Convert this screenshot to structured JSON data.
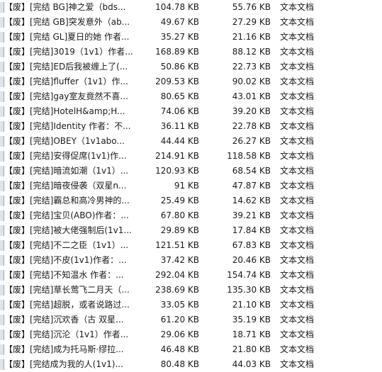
{
  "files": [
    {
      "name": "【废】[完结 BG]神之爱（bds...",
      "size": "104.78 KB",
      "csize": "55.76 KB",
      "type": "文本文档"
    },
    {
      "name": "【废】[完结 GB]突发意外（ab...",
      "size": "49.67 KB",
      "csize": "27.29 KB",
      "type": "文本文档"
    },
    {
      "name": "【废】[完结 GL]夏日的她 作者...",
      "size": "35.27 KB",
      "csize": "21.16 KB",
      "type": "文本文档"
    },
    {
      "name": "【废】[完结]3019（1v1）作者...",
      "size": "168.89 KB",
      "csize": "88.12 KB",
      "type": "文本文档"
    },
    {
      "name": "【废】[完结]ED后我被缠上了(...",
      "size": "50.86 KB",
      "csize": "22.73 KB",
      "type": "文本文档"
    },
    {
      "name": "【废】[完结]fluffer（1v1）作...",
      "size": "209.53 KB",
      "csize": "90.02 KB",
      "type": "文本文档"
    },
    {
      "name": "【废】[完结]gay室友竟然不喜...",
      "size": "80.65 KB",
      "csize": "43.01 KB",
      "type": "文本文档"
    },
    {
      "name": "【废】[完结]HotelH&amp;H...",
      "size": "74.06 KB",
      "csize": "39.20 KB",
      "type": "文本文档"
    },
    {
      "name": "【废】[完结]Identity 作者：不...",
      "size": "36.11 KB",
      "csize": "22.78 KB",
      "type": "文本文档"
    },
    {
      "name": "【废】[完结]OBEY（1v1abo...",
      "size": "44.44 KB",
      "csize": "26.27 KB",
      "type": "文本文档"
    },
    {
      "name": "【废】[完结]安得促席(1v1)作...",
      "size": "214.91 KB",
      "csize": "118.58 KB",
      "type": "文本文档"
    },
    {
      "name": "【废】[完结]暗流如潮（1v1）...",
      "size": "120.93 KB",
      "csize": "68.54 KB",
      "type": "文本文档"
    },
    {
      "name": "【废】[完结]暗夜侵袭（双星n...",
      "size": "91 KB",
      "csize": "47.87 KB",
      "type": "文本文档"
    },
    {
      "name": "【废】[完结]霸总和高冷男神的...",
      "size": "25.49 KB",
      "csize": "14.62 KB",
      "type": "文本文档"
    },
    {
      "name": "【废】[完结]宝贝(ABO)作者：...",
      "size": "67.80 KB",
      "csize": "39.21 KB",
      "type": "文本文档"
    },
    {
      "name": "【废】[完结]被大佬强制后(1v1...",
      "size": "29.89 KB",
      "csize": "17.84 KB",
      "type": "文本文档"
    },
    {
      "name": "【废】[完结]不二之臣（1v1）...",
      "size": "121.51 KB",
      "csize": "67.83 KB",
      "type": "文本文档"
    },
    {
      "name": "【废】[完结]不皮(1v1)作者：...",
      "size": "37.42 KB",
      "csize": "20.46 KB",
      "type": "文本文档"
    },
    {
      "name": "【废】[完结]不知温水 作者：...",
      "size": "292.04 KB",
      "csize": "154.74 KB",
      "type": "文本文档"
    },
    {
      "name": "【废】[完结]草长莺飞二月天（...",
      "size": "238.69 KB",
      "csize": "135.30 KB",
      "type": "文本文档"
    },
    {
      "name": "【废】[完结]超脱，或者说路过...",
      "size": "33.05 KB",
      "csize": "21.10 KB",
      "type": "文本文档"
    },
    {
      "name": "【废】[完结]沉欢香（古 双星...",
      "size": "61.20 KB",
      "csize": "35.19 KB",
      "type": "文本文档"
    },
    {
      "name": "【废】[完结]沉沦（1v1）作者...",
      "size": "29.06 KB",
      "csize": "18.71 KB",
      "type": "文本文档"
    },
    {
      "name": "【废】[完结]成为托马斯·缪拉...",
      "size": "46.48 KB",
      "csize": "21.80 KB",
      "type": "文本文档"
    },
    {
      "name": "【废】[完结成为我的人(1v1)...",
      "size": "80.48 KB",
      "csize": "44.03 KB",
      "type": "文本文档"
    }
  ]
}
